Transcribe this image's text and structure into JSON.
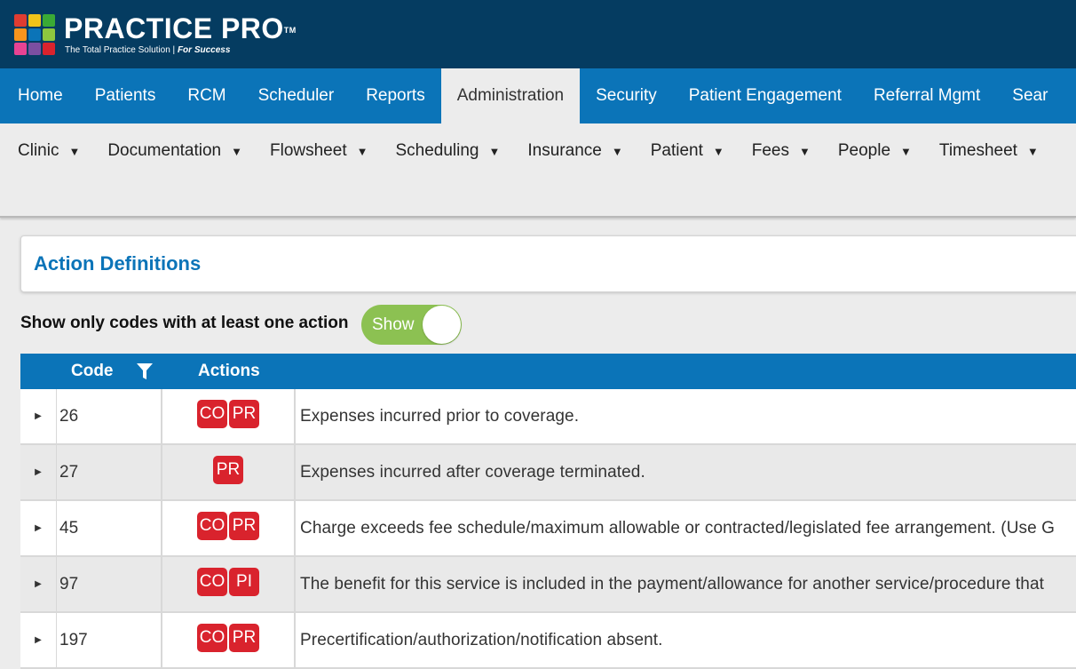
{
  "brand": {
    "name": "PRACTICE PRO",
    "tm": "TM",
    "tagline_main": "The Total Practice Solution | ",
    "tagline_em": "For Success",
    "grid_colors": [
      "#e03c31",
      "#f0c419",
      "#3aaa35",
      "#f7941d",
      "#0b74b8",
      "#8dc63f",
      "#e84393",
      "#7b4fa1",
      "#d9232d"
    ]
  },
  "main_nav": {
    "items": [
      "Home",
      "Patients",
      "RCM",
      "Scheduler",
      "Reports",
      "Administration",
      "Security",
      "Patient Engagement",
      "Referral Mgmt",
      "Sear"
    ],
    "active": "Administration"
  },
  "sub_nav": {
    "items": [
      "Clinic",
      "Documentation",
      "Flowsheet",
      "Scheduling",
      "Insurance",
      "Patient",
      "Fees",
      "People",
      "Timesheet"
    ],
    "caret": "▼"
  },
  "page": {
    "title": "Action Definitions"
  },
  "filter": {
    "label": "Show only codes with at least one action",
    "toggle_label": "Show",
    "toggle_on": true
  },
  "grid": {
    "columns": [
      "Code",
      "Actions"
    ],
    "expander_glyph": "▶",
    "rows": [
      {
        "code": "26",
        "actions": [
          "CO",
          "PR"
        ],
        "description": "Expenses incurred prior to coverage."
      },
      {
        "code": "27",
        "actions": [
          "PR"
        ],
        "description": "Expenses incurred after coverage terminated."
      },
      {
        "code": "45",
        "actions": [
          "CO",
          "PR"
        ],
        "description": "Charge exceeds fee schedule/maximum allowable or contracted/legislated fee arrangement. (Use G"
      },
      {
        "code": "97",
        "actions": [
          "CO",
          "PI"
        ],
        "description": "The benefit for this service is included in the payment/allowance for another service/procedure that"
      },
      {
        "code": "197",
        "actions": [
          "CO",
          "PR"
        ],
        "description": "Precertification/authorization/notification absent."
      }
    ]
  },
  "colors": {
    "header_bg": "#053c61",
    "nav_bg": "#0b74b8",
    "accent": "#0b74b8",
    "badge": "#d9232d",
    "toggle_on": "#8cc152"
  }
}
